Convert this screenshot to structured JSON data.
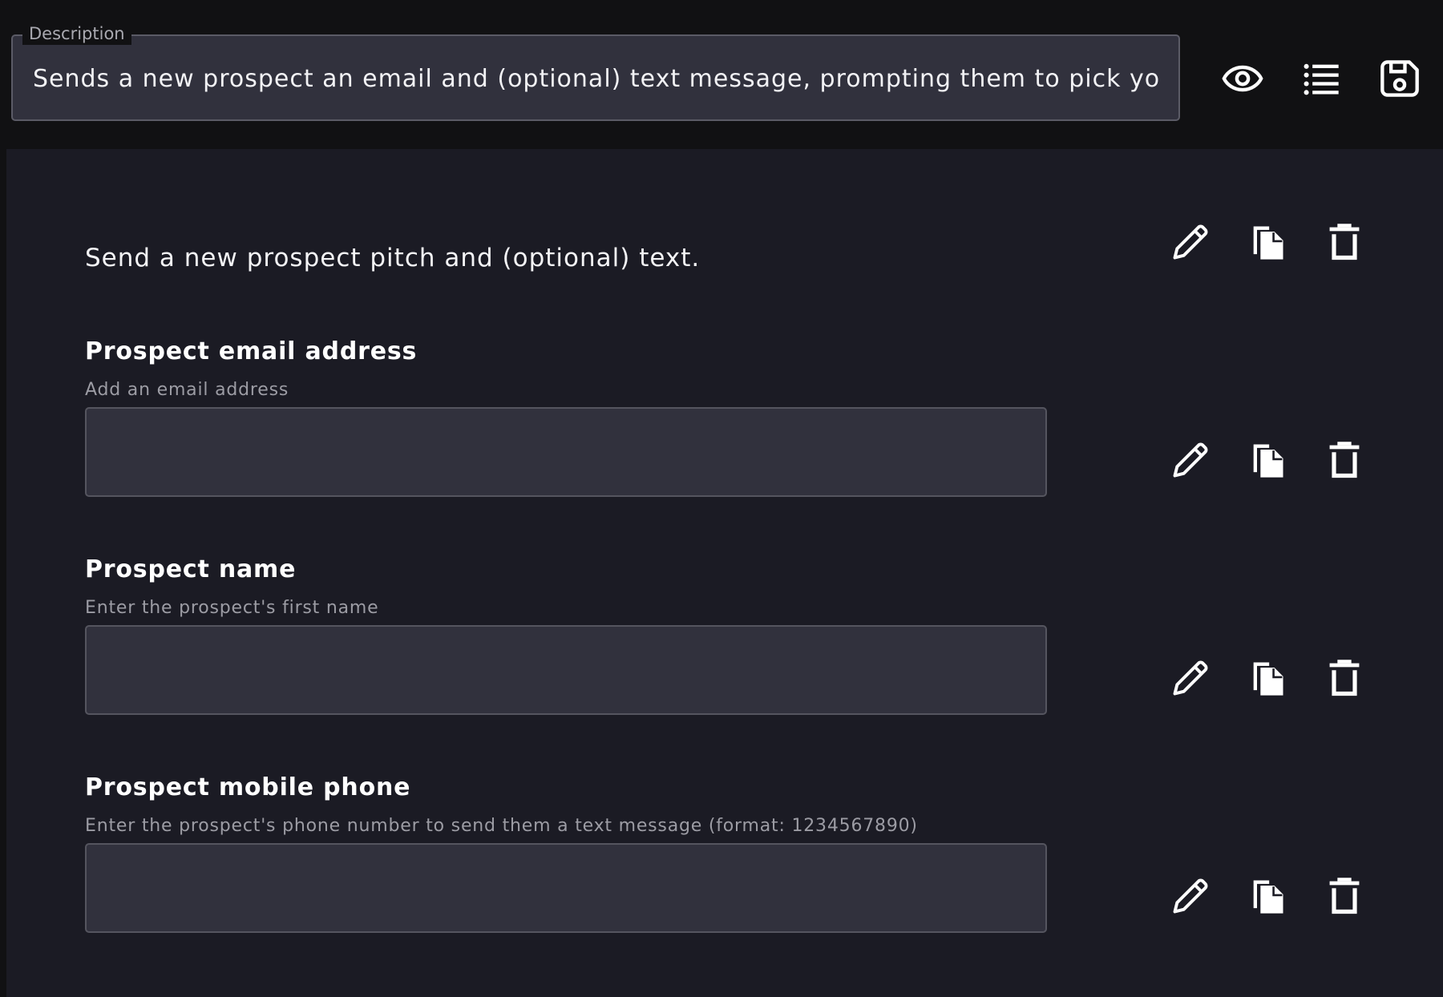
{
  "header": {
    "description_label": "Description",
    "description_value": "Sends a new prospect an email and (optional) text message, prompting them to pick your",
    "actions": {
      "preview_icon": "eye-icon",
      "list_icon": "list-icon",
      "save_icon": "save-icon"
    }
  },
  "form": {
    "intro_text": "Send a new prospect pitch and (optional) text.",
    "fields": [
      {
        "label": "Prospect email address",
        "help": "Add an email address",
        "value": ""
      },
      {
        "label": "Prospect name",
        "help": "Enter the prospect's first name",
        "value": ""
      },
      {
        "label": "Prospect mobile phone",
        "help": "Enter the prospect's phone number to send them a text message (format: 1234567890)",
        "value": ""
      }
    ],
    "row_action_icons": [
      "pencil-icon",
      "copy-icon",
      "trash-icon"
    ]
  },
  "colors": {
    "page_background": "#111113",
    "panel_background": "#1b1b24",
    "input_background": "#31313d",
    "input_border": "#55555f",
    "muted_text": "#9c9ca4"
  }
}
